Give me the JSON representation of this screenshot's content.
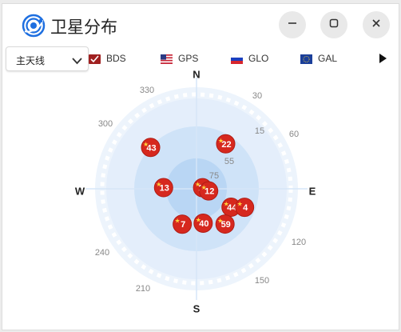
{
  "window": {
    "title": "卫星分布"
  },
  "toolbar": {
    "antenna_select": {
      "value": "主天线"
    },
    "constellations": [
      {
        "label": "BDS"
      },
      {
        "label": "GPS"
      },
      {
        "label": "GLO"
      },
      {
        "label": "GAL"
      }
    ]
  },
  "icons": {
    "app": "satellite-orbit-icon",
    "minimize": "minimize-icon",
    "maximize": "maximize-icon",
    "close": "close-icon",
    "chevron": "chevron-down-icon",
    "play": "play-icon"
  },
  "colors": {
    "accent": "#1e6fe0",
    "satellite_fill": "#d6281e",
    "ring_outer": "#e6f0fb",
    "ring_mid": "#cfe3f8",
    "ring_inner": "#b9d6f4"
  },
  "skyplot": {
    "directions": {
      "n": "N",
      "e": "E",
      "s": "S",
      "w": "W"
    },
    "azimuth_labels": [
      "330",
      "30",
      "300",
      "60",
      "120",
      "240",
      "150",
      "210"
    ],
    "elevation_labels": [
      "15",
      "55",
      "75"
    ],
    "satellites": [
      {
        "prn": "43",
        "azimuth": 312,
        "elevation": 30
      },
      {
        "prn": "22",
        "azimuth": 33,
        "elevation": 38
      },
      {
        "prn": "13",
        "azimuth": 272,
        "elevation": 58
      },
      {
        "prn": "21",
        "azimuth": 80,
        "elevation": 84
      },
      {
        "prn": "12",
        "azimuth": 100,
        "elevation": 78
      },
      {
        "prn": "44",
        "azimuth": 118,
        "elevation": 52
      },
      {
        "prn": "4",
        "azimuth": 111,
        "elevation": 40
      },
      {
        "prn": "7",
        "azimuth": 202,
        "elevation": 53
      },
      {
        "prn": "40",
        "azimuth": 169,
        "elevation": 56
      },
      {
        "prn": "59",
        "azimuth": 141,
        "elevation": 46
      }
    ]
  }
}
